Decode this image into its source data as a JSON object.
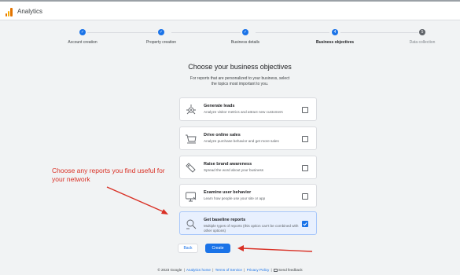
{
  "app": {
    "title": "Analytics",
    "logo_icon": "analytics-logo-icon"
  },
  "stepper": {
    "steps": [
      {
        "label": "Account creation",
        "state": "done",
        "marker": "✓"
      },
      {
        "label": "Property creation",
        "state": "done",
        "marker": "✓"
      },
      {
        "label": "Business details",
        "state": "done",
        "marker": "✓"
      },
      {
        "label": "Business objectives",
        "state": "current",
        "marker": "4"
      },
      {
        "label": "Data collection",
        "state": "upcoming",
        "marker": "5"
      }
    ]
  },
  "main": {
    "heading": "Choose your business objectives",
    "subtext": "For reports that are personalized to your business, select the topics most important to you.",
    "objectives": [
      {
        "title": "Generate leads",
        "description": "Analyze visitor metrics and attract new customers",
        "checked": false,
        "icon": "target-icon"
      },
      {
        "title": "Drive online sales",
        "description": "Analyze purchase behavior and get more sales",
        "checked": false,
        "icon": "cart-icon"
      },
      {
        "title": "Raise brand awareness",
        "description": "Spread the word about your business",
        "checked": false,
        "icon": "tag-icon"
      },
      {
        "title": "Examine user behavior",
        "description": "Learn how people use your site or app",
        "checked": false,
        "icon": "monitor-icon"
      },
      {
        "title": "Get baseline reports",
        "description": "Multiple types of reports (this option can't be combined with other options)",
        "checked": true,
        "icon": "search-report-icon"
      }
    ],
    "back_label": "Back",
    "create_label": "Create"
  },
  "annotation": {
    "text": "Choose any reports you find useful for your network",
    "color": "#d93025"
  },
  "footer": {
    "copyright": "© 2023 Google",
    "links": [
      "Analytics home",
      "Terms of Service",
      "Privacy Policy"
    ],
    "feedback": "Send feedback"
  },
  "colors": {
    "accent": "#1a73e8",
    "selected_card": "#e8f0fe",
    "annotation": "#d93025"
  }
}
